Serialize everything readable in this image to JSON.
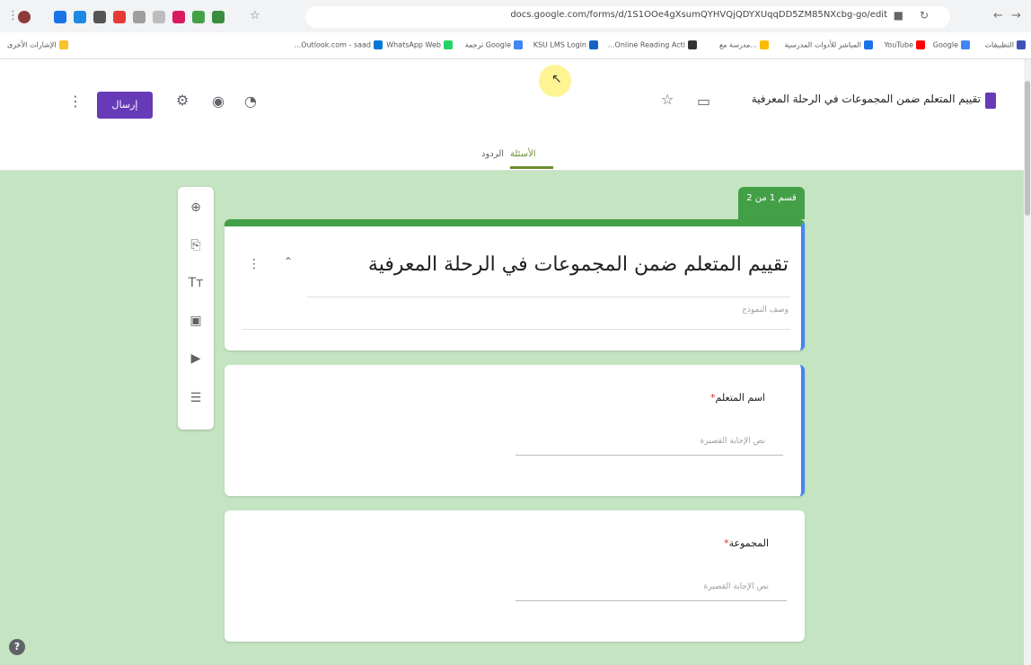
{
  "browser": {
    "url": "docs.google.com/forms/d/1S1OOe4gXsumQYHVQjQDYXUqqDD5ZM85NXcbg-go/edit",
    "url_icons": [
      "puzzle-icon",
      "refresh-icon"
    ],
    "nav_icons": [
      "back-icon",
      "forward-icon"
    ]
  },
  "bookmarks": [
    {
      "label": "التطبيقات",
      "color": "#3f51b5"
    },
    {
      "label": "Google",
      "color": "#4285f4"
    },
    {
      "label": "YouTube",
      "color": "#ff0000"
    },
    {
      "label": "المباشر للأدوات المدرسية",
      "color": "#1a73e8"
    },
    {
      "label": "...مدرسة مع",
      "color": "#fbbc04"
    },
    {
      "label": "Online Reading Acti...",
      "color": "#333333"
    },
    {
      "label": "KSU LMS Login",
      "color": "#1565c0"
    },
    {
      "label": "Google ترجمة",
      "color": "#4285f4"
    },
    {
      "label": "WhatsApp Web",
      "color": "#25d366"
    },
    {
      "label": "Outlook.com - saad...",
      "color": "#0078d4"
    },
    {
      "label": "الإشارات الأخرى",
      "color": "#fbc02d"
    }
  ],
  "header": {
    "doc_title": "تقييم المتعلم ضمن المجموعات في الرحلة المعرفية",
    "send_label": "إرسال",
    "tabs": [
      {
        "label": "الأسئلة",
        "active": true
      },
      {
        "label": "الردود",
        "active": false
      }
    ]
  },
  "toolbar_icons": [
    "add-question-icon",
    "import-questions-icon",
    "add-title-icon",
    "add-image-icon",
    "add-video-icon",
    "add-section-icon"
  ],
  "form": {
    "section_label": "قسم 1 من 2",
    "title": "تقييم المتعلم ضمن المجموعات في الرحلة المعرفية",
    "description_placeholder": "وصف النموذج",
    "questions": [
      {
        "label": "اسم المتعلم",
        "required": "*",
        "answer_placeholder": "نص الإجابة القصيرة"
      },
      {
        "label": "المجموعة",
        "required": "*",
        "answer_placeholder": "نص الإجابة القصيرة"
      }
    ]
  },
  "colors": {
    "accent": "#673ab7",
    "background": "#c5e4c1",
    "section": "#43a047",
    "active_border": "#4285f4"
  }
}
